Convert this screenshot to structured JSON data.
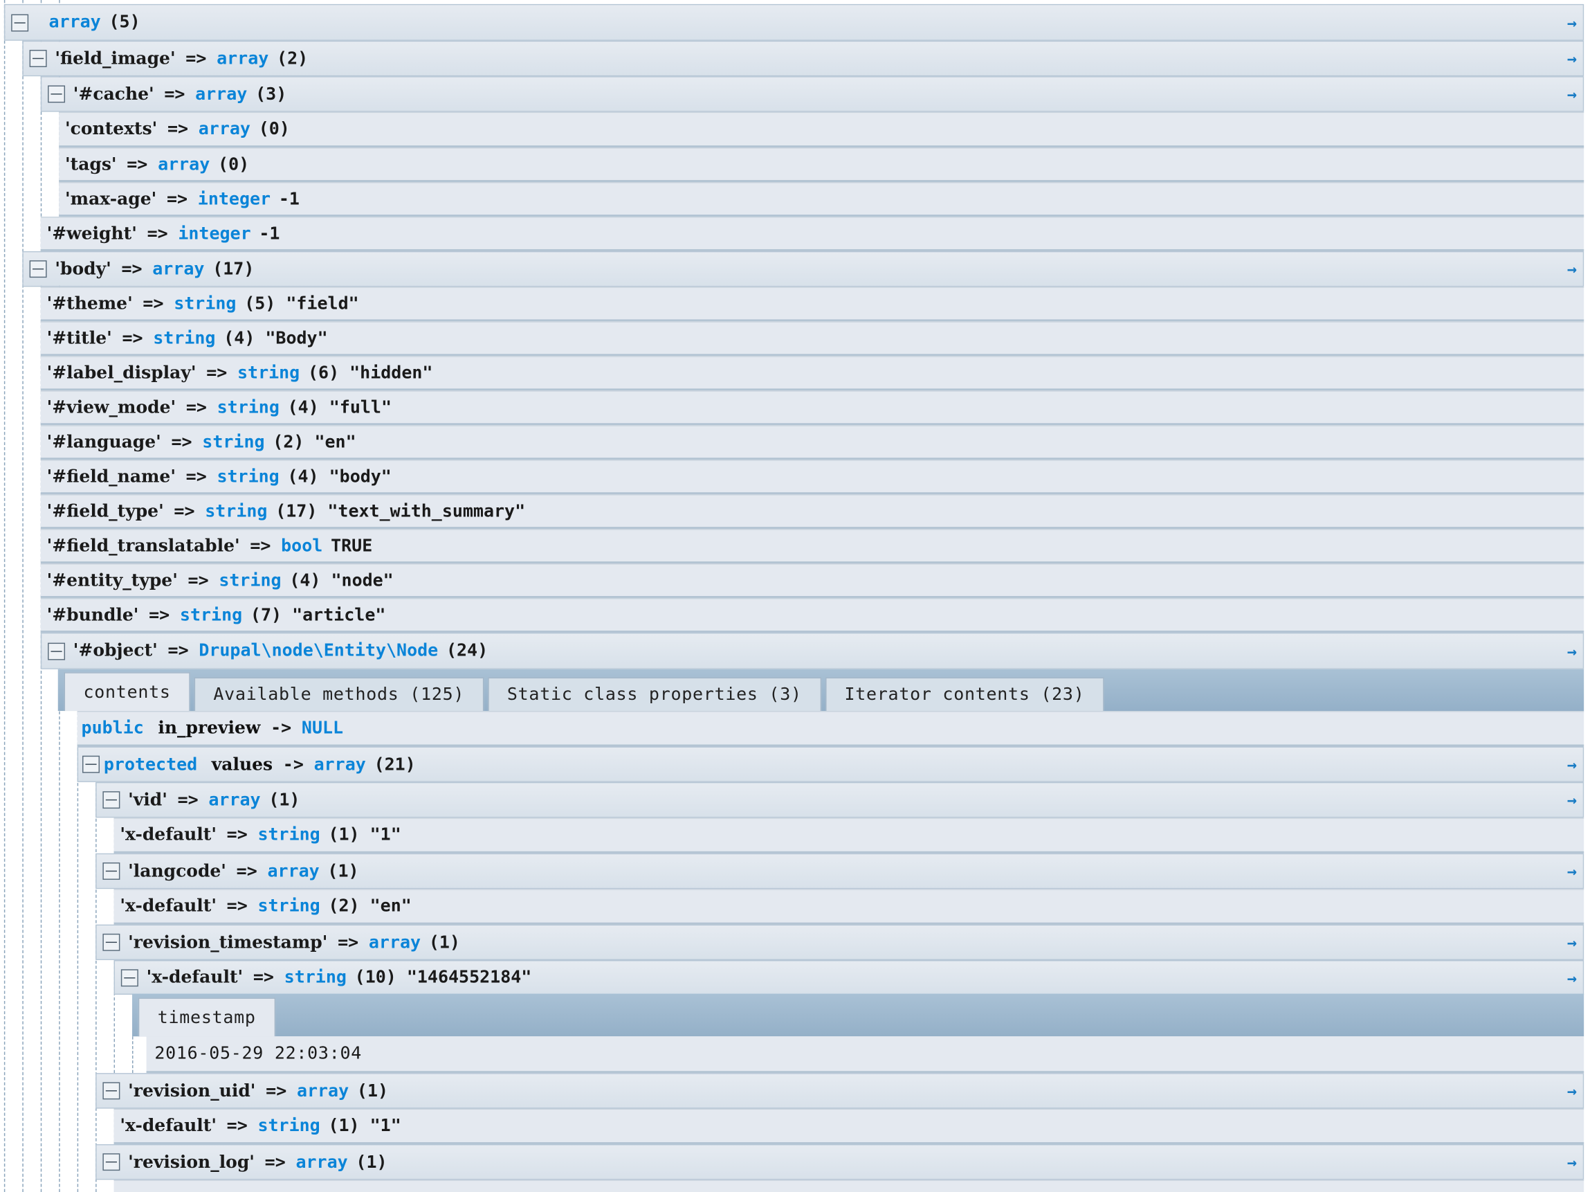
{
  "rows": [
    {
      "key": "array",
      "count": "(5)",
      "root": true
    },
    {
      "key": "'field_image'",
      "op": "=>",
      "type": "array",
      "val": "(2)"
    },
    {
      "key": "'#cache'",
      "op": "=>",
      "type": "array",
      "val": "(3)"
    },
    {
      "key": "'contexts'",
      "op": "=>",
      "type": "array",
      "val": "(0)"
    },
    {
      "key": "'tags'",
      "op": "=>",
      "type": "array",
      "val": "(0)"
    },
    {
      "key": "'max-age'",
      "op": "=>",
      "type": "integer",
      "val": "-1"
    },
    {
      "key": "'#weight'",
      "op": "=>",
      "type": "integer",
      "val": "-1"
    },
    {
      "key": "'body'",
      "op": "=>",
      "type": "array",
      "val": "(17)"
    },
    {
      "key": "'#theme'",
      "op": "=>",
      "type": "string",
      "val": "(5) \"field\""
    },
    {
      "key": "'#title'",
      "op": "=>",
      "type": "string",
      "val": "(4) \"Body\""
    },
    {
      "key": "'#label_display'",
      "op": "=>",
      "type": "string",
      "val": "(6) \"hidden\""
    },
    {
      "key": "'#view_mode'",
      "op": "=>",
      "type": "string",
      "val": "(4) \"full\""
    },
    {
      "key": "'#language'",
      "op": "=>",
      "type": "string",
      "val": "(2) \"en\""
    },
    {
      "key": "'#field_name'",
      "op": "=>",
      "type": "string",
      "val": "(4) \"body\""
    },
    {
      "key": "'#field_type'",
      "op": "=>",
      "type": "string",
      "val": "(17) \"text_with_summary\""
    },
    {
      "key": "'#field_translatable'",
      "op": "=>",
      "type": "bool",
      "val": "TRUE"
    },
    {
      "key": "'#entity_type'",
      "op": "=>",
      "type": "string",
      "val": "(4) \"node\""
    },
    {
      "key": "'#bundle'",
      "op": "=>",
      "type": "string",
      "val": "(7) \"article\""
    },
    {
      "key": "'#object'",
      "op": "=>",
      "type": "Drupal\\node\\Entity\\Node",
      "val": "(24)"
    },
    {
      "visibility": "public",
      "prop": "in_preview",
      "op": "->",
      "type": "NULL",
      "val": ""
    },
    {
      "visibility": "protected",
      "prop": "values",
      "op": "->",
      "type": "array",
      "val": "(21)"
    },
    {
      "key": "'vid'",
      "op": "=>",
      "type": "array",
      "val": "(1)"
    },
    {
      "key": "'x-default'",
      "op": "=>",
      "type": "string",
      "val": "(1) \"1\""
    },
    {
      "key": "'langcode'",
      "op": "=>",
      "type": "array",
      "val": "(1)"
    },
    {
      "key": "'x-default'",
      "op": "=>",
      "type": "string",
      "val": "(2) \"en\""
    },
    {
      "key": "'revision_timestamp'",
      "op": "=>",
      "type": "array",
      "val": "(1)"
    },
    {
      "key": "'x-default'",
      "op": "=>",
      "type": "string",
      "val": "(10) \"1464552184\""
    },
    {
      "key": "'revision_uid'",
      "op": "=>",
      "type": "array",
      "val": "(1)"
    },
    {
      "key": "'x-default'",
      "op": "=>",
      "type": "string",
      "val": "(1) \"1\""
    },
    {
      "key": "'revision_log'",
      "op": "=>",
      "type": "array",
      "val": "(1)"
    }
  ],
  "object_tabs": [
    "contents",
    "Available methods (125)",
    "Static class properties (3)",
    "Iterator contents (23)"
  ],
  "timestamp_tab": "timestamp",
  "timestamp_value": "2016-05-29 22:03:04",
  "expand_arrow": "→",
  "colors": {
    "accent": "#0a84d8",
    "row_bg": "#e4e9f0",
    "tab_bar": "#a9c1d5"
  }
}
